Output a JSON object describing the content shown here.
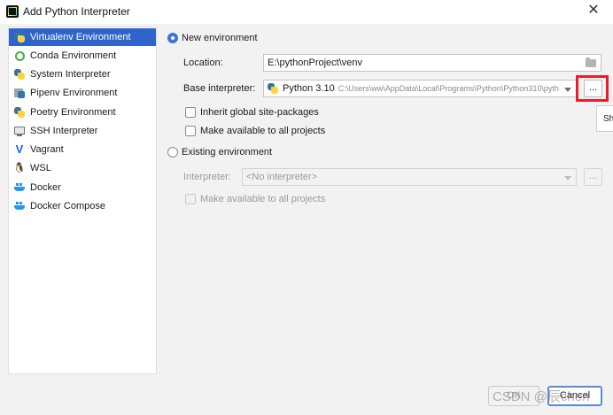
{
  "window": {
    "title": "Add Python Interpreter",
    "close_glyph": "✕"
  },
  "sidebar": {
    "items": [
      {
        "label": "Virtualenv Environment",
        "icon": "python-icon",
        "active": true
      },
      {
        "label": "Conda Environment",
        "icon": "conda-icon"
      },
      {
        "label": "System Interpreter",
        "icon": "python-icon"
      },
      {
        "label": "Pipenv Environment",
        "icon": "pipenv-icon"
      },
      {
        "label": "Poetry Environment",
        "icon": "poetry-icon"
      },
      {
        "label": "SSH Interpreter",
        "icon": "ssh-icon"
      },
      {
        "label": "Vagrant",
        "icon": "vagrant-icon"
      },
      {
        "label": "WSL",
        "icon": "linux-icon"
      },
      {
        "label": "Docker",
        "icon": "docker-icon"
      },
      {
        "label": "Docker Compose",
        "icon": "docker-icon"
      }
    ]
  },
  "new_env": {
    "radio_label": "New environment",
    "selected": true,
    "location_label": "Location:",
    "location_value": "E:\\pythonProject\\venv",
    "base_label": "Base interpreter:",
    "base_name": "Python 3.10",
    "base_path": "C:\\Users\\ww\\AppData\\Local\\Programs\\Python\\Python310\\pyth",
    "browse_label": "...",
    "inherit_label": "Inherit global site-packages",
    "make_available_label": "Make available to all projects"
  },
  "existing_env": {
    "radio_label": "Existing environment",
    "selected": false,
    "interpreter_label": "Interpreter:",
    "interpreter_placeholder": "<No interpreter>",
    "browse_label": "...",
    "make_available_label": "Make available to all projects"
  },
  "tooltip_text": "Sh",
  "footer": {
    "ok_label": "OK",
    "cancel_label": "Cancel"
  },
  "watermark": "CSDN @辰chen",
  "colors": {
    "accent": "#2f65ca",
    "highlight": "#ee1c24"
  }
}
